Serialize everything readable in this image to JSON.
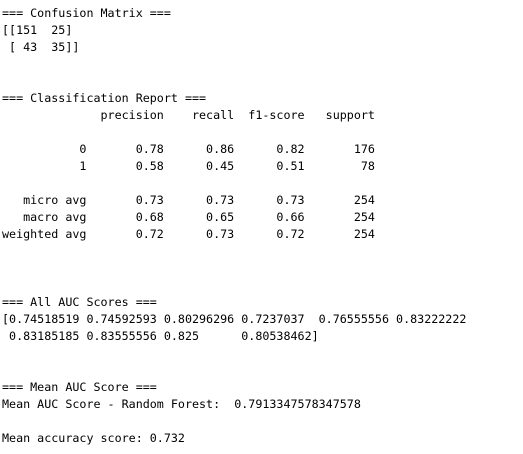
{
  "output": {
    "lines": [
      "=== Confusion Matrix ===",
      "[[151  25]",
      " [ 43  35]]",
      "",
      "",
      "=== Classification Report ===",
      "              precision    recall  f1-score   support",
      "",
      "           0       0.78      0.86      0.82       176",
      "           1       0.58      0.45      0.51        78",
      "",
      "   micro avg       0.73      0.73      0.73       254",
      "   macro avg       0.68      0.65      0.66       254",
      "weighted avg       0.72      0.73      0.72       254",
      "",
      "",
      "",
      "=== All AUC Scores ===",
      "[0.74518519 0.74592593 0.80296296 0.7237037  0.76555556 0.83222222",
      " 0.83185185 0.83555556 0.825      0.80538462]",
      "",
      "",
      "=== Mean AUC Score ===",
      "Mean AUC Score - Random Forest:  0.7913347578347578",
      "",
      "Mean accuracy score: 0.732"
    ]
  }
}
